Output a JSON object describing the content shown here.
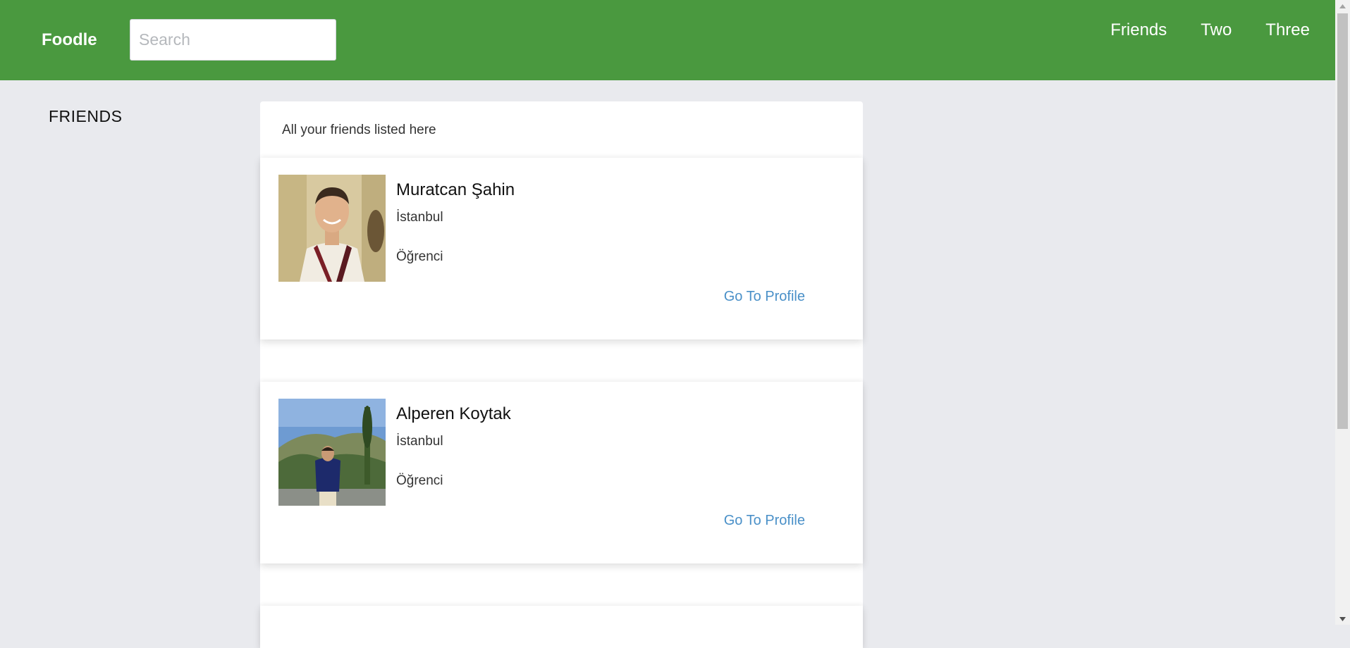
{
  "navbar": {
    "brand": "Foodle",
    "search_placeholder": "Search",
    "links": [
      "Friends",
      "Two",
      "Three"
    ],
    "color": "#4a993f"
  },
  "sidebar": {
    "title": "FRIENDS"
  },
  "main": {
    "header": "All your friends listed here",
    "friends": [
      {
        "name": "Muratcan Şahin",
        "city": "İstanbul",
        "occupation": "Öğrenci",
        "link_label": "Go To Profile"
      },
      {
        "name": "Alperen Koytak",
        "city": "İstanbul",
        "occupation": "Öğrenci",
        "link_label": "Go To Profile"
      }
    ]
  },
  "colors": {
    "background": "#e9eaee",
    "link": "#4a90c8"
  }
}
